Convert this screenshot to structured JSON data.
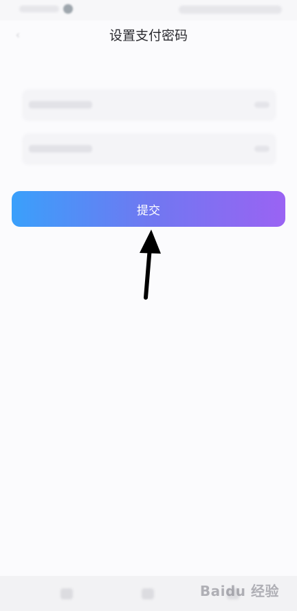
{
  "header": {
    "title": "设置支付密码",
    "back_icon": "back-arrow-icon"
  },
  "form": {
    "fields": [
      {
        "name": "password",
        "icon": "eye-icon"
      },
      {
        "name": "confirm-password",
        "icon": "eye-icon"
      }
    ],
    "submit_label": "提交"
  },
  "colors": {
    "submit_gradient_start": "#3aa0fb",
    "submit_gradient_end": "#9a63f3",
    "background": "#fbfbfd",
    "title_text": "#2a2a2f"
  },
  "watermark": {
    "text": "Baidu 经验"
  }
}
